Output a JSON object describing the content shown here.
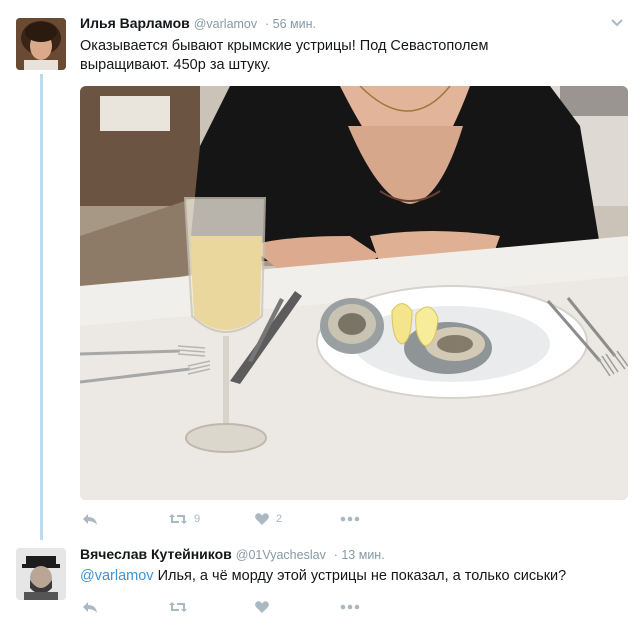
{
  "tweet": {
    "author_name": "Илья Варламов",
    "author_handle": "@varlamov",
    "time": "· 56 мин.",
    "text": "Оказывается бывают крымские устрицы! Под Севастополем выращивают. 450р за штуку.",
    "retweets": "9",
    "likes": "2"
  },
  "reply": {
    "author_name": "Вячеслав Кутейников",
    "author_handle": "@01Vyacheslav",
    "time": "· 13 мин.",
    "mention": "@varlamov",
    "text": " Илья, а чё морду этой устрицы не показал, а только сиськи?"
  },
  "icons": {
    "reply": "reply-icon",
    "retweet": "retweet-icon",
    "like": "heart-icon",
    "more": "more-dots-icon",
    "caret": "chevron-down-icon"
  },
  "colors": {
    "name": "#14171a",
    "meta": "#8899a6",
    "link": "#3b94d9",
    "action": "#aab8c2",
    "thread": "#b9dcf3"
  }
}
